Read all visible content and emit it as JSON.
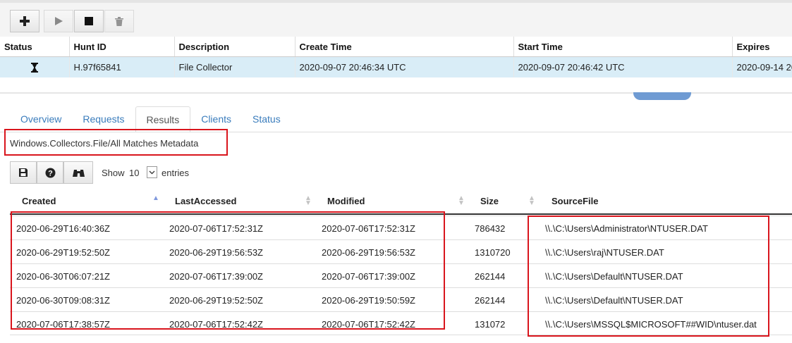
{
  "toolbar": {
    "icons": [
      "plus-icon",
      "play-icon",
      "stop-icon",
      "trash-icon"
    ]
  },
  "hunts_table": {
    "columns": [
      "Status",
      "Hunt ID",
      "Description",
      "Create Time",
      "Start Time",
      "Expires"
    ],
    "row": {
      "status_icon": "hourglass-icon",
      "hunt_id": "H.97f65841",
      "description": "File Collector",
      "create_time": "2020-09-07 20:46:34 UTC",
      "start_time": "2020-09-07 20:46:42 UTC",
      "expires": "2020-09-14 20"
    }
  },
  "tabs": [
    "Overview",
    "Requests",
    "Results",
    "Clients",
    "Status"
  ],
  "active_tab": "Results",
  "artifact_source": "Windows.Collectors.File/All Matches Metadata",
  "table_controls": {
    "icons": [
      "save-icon",
      "help-icon",
      "binoculars-icon"
    ],
    "show_label": "Show",
    "page_size": "10",
    "entries_label": "entries"
  },
  "results": {
    "columns": [
      "Created",
      "LastAccessed",
      "Modified",
      "Size",
      "SourceFile"
    ],
    "rows": [
      [
        "2020-06-29T16:40:36Z",
        "2020-07-06T17:52:31Z",
        "2020-07-06T17:52:31Z",
        "786432",
        "\\\\.\\C:\\Users\\Administrator\\NTUSER.DAT"
      ],
      [
        "2020-06-29T19:52:50Z",
        "2020-06-29T19:56:53Z",
        "2020-06-29T19:56:53Z",
        "1310720",
        "\\\\.\\C:\\Users\\raj\\NTUSER.DAT"
      ],
      [
        "2020-06-30T06:07:21Z",
        "2020-07-06T17:39:00Z",
        "2020-07-06T17:39:00Z",
        "262144",
        "\\\\.\\C:\\Users\\Default\\NTUSER.DAT"
      ],
      [
        "2020-06-30T09:08:31Z",
        "2020-06-29T19:52:50Z",
        "2020-06-29T19:50:59Z",
        "262144",
        "\\\\.\\C:\\Users\\Default\\NTUSER.DAT"
      ],
      [
        "2020-07-06T17:38:57Z",
        "2020-07-06T17:52:42Z",
        "2020-07-06T17:52:42Z",
        "131072",
        "\\\\.\\C:\\Users\\MSSQL$MICROSOFT##WID\\ntuser.dat"
      ]
    ]
  },
  "colors": {
    "highlight": "#d9151d",
    "selected_row": "#d9edf7",
    "link": "#3a7cbc"
  }
}
